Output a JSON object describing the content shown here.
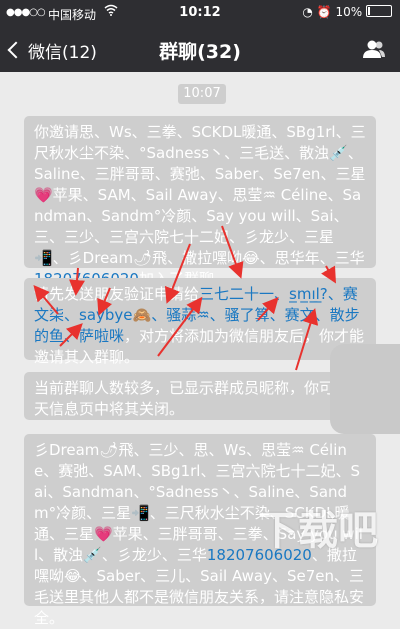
{
  "status_bar": {
    "signal": "●●●○○",
    "carrier": "中国移动",
    "wifi_icon": "wifi-icon",
    "time": "10:12",
    "battery": "10%",
    "battery_level": 0.1
  },
  "nav": {
    "back_label": "微信(12)",
    "title": "群聊(32)",
    "group_info_icon": "people-icon"
  },
  "chat": {
    "timestamp": "10:07",
    "msg1_text": "你邀请思、Ws、三拳、SCKDL暖通、SBg1rl、三尺秋水尘不染、°Sadness丶、三毛送、散浊💉、Saline、三胖哥哥、赛弛、Saber、Se7en、三星💗苹果、SAM、Sail Away、思莹♒ Céline、Sandman、Sandm°冷颜、Say you will、Sai、三、三少、三宫六院七十二妃、彡龙少、三星📲、彡Dream🌶飛、撒拉嘿呦😂、思华年、三华",
    "msg1_phone": "18207606020",
    "msg1_suffix": "加入了群聊",
    "msg2_prefix": "请先发送朋友验证申请给",
    "msg2_names": "三七二十一、s̲m̲ı̲̲l̲?、赛文柒、saybye🙈、骚蒜♒、骚了算、赛文、散步的鱼、萨啦咪",
    "msg2_suffix": "，对方将添加为微信朋友后，你才能邀请其入群聊。",
    "msg3_text": "当前群聊人数较多，已显示群成员昵称，你可在聊天信息页中将其关闭。",
    "msg4_text": "彡Dream🌶飛、三少、思、Ws、思莹♒ Céline、赛弛、SAM、SBg1rl、三宫六院七十二妃、Sai、Sandman、°Sadness丶、Saline、Sandm°冷颜、三星📲、三尺秋水尘不染、SCKDL暖通、三星💗苹果、三胖哥哥、三拳、Say you will、散浊💉、彡龙少、三华",
    "msg4_phone": "18207606020",
    "msg4_mid": "、撒拉嘿呦😂、Saber、三儿、Sail Away、Se7en、三毛送",
    "msg4_suffix": "里其他人都不是微信朋友关系，请注意隐私安全。"
  },
  "watermark": {
    "text": "下载吧"
  },
  "colors": {
    "bar": "#2e2e32",
    "bubble": "#cecece",
    "link": "#1a78c2",
    "annotation": "#e8322e"
  }
}
